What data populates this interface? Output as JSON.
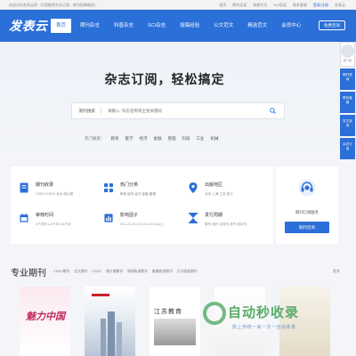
{
  "topbar": {
    "welcome": "欢迎访问发表云网（为您推荐杂志订阅、期刊投稿服务）",
    "links": [
      "首页",
      "期刊导读",
      "热搜专刊",
      "SCI导读",
      "联系客服"
    ],
    "login": "登录/注册",
    "app": "发表云"
  },
  "nav": {
    "logo": "发表云",
    "items": [
      "首页",
      "期刊杂志",
      "科普杂志",
      "SCI杂志",
      "投稿经验",
      "公文范文",
      "精选范文",
      "会员中心"
    ],
    "button": "免费咨询"
  },
  "hero": {
    "slogan": "杂志订阅，轻松搞定",
    "search_category": "期刊搜索",
    "search_placeholder": "请输入: 杂志名称或主管关键词",
    "hot_label": "热门搜索：",
    "hot_items": [
      "教育",
      "医学",
      "经济",
      "金融",
      "管理",
      "科技",
      "工业",
      "机械"
    ]
  },
  "rail": {
    "avatar_caption": "扫一扫",
    "buttons": [
      "期刊咨询",
      "联系客服",
      "发文咨询",
      "杂志订阅"
    ]
  },
  "features": [
    {
      "title": "期刊收录",
      "desc": "CSSCI  CSCD  北大  统计源",
      "icon": "book-icon"
    },
    {
      "title": "热门分类",
      "desc": "教育  医学  经济  金融  管理",
      "icon": "grid-icon"
    },
    {
      "title": "出版地区",
      "desc": "北京  上海  江苏  浙江",
      "icon": "location-icon"
    },
    {
      "title": "审核时间",
      "desc": "1个月内  1-3个月  3-6个月",
      "icon": "calendar-icon"
    },
    {
      "title": "影响因子",
      "desc": "0.5-1.0  1.0-1.5  1.5-2.0  2.0以上",
      "icon": "chart-icon"
    },
    {
      "title": "发行周期",
      "desc": "周刊  旬刊  半月刊  月刊  双月刊",
      "icon": "hourglass-icon"
    }
  ],
  "service": {
    "label": "期刊订阅服务",
    "button": "期刊咨询"
  },
  "section": {
    "title": "专业期刊",
    "tabs": [
      "CSSC期刊",
      "北大期刊",
      "CSCD",
      "统计源期刊",
      "知网收录期刊",
      "维普收录期刊",
      "万方收录期刊"
    ],
    "more": "更多"
  },
  "covers": [
    {
      "title": "魅力中国"
    },
    {
      "title": ""
    },
    {
      "title": "江苏教育"
    },
    {
      "title": ""
    },
    {
      "title": ""
    }
  ],
  "watermark": {
    "big": "自动秒收录",
    "small": "数上传统一来一次一自动收录"
  }
}
